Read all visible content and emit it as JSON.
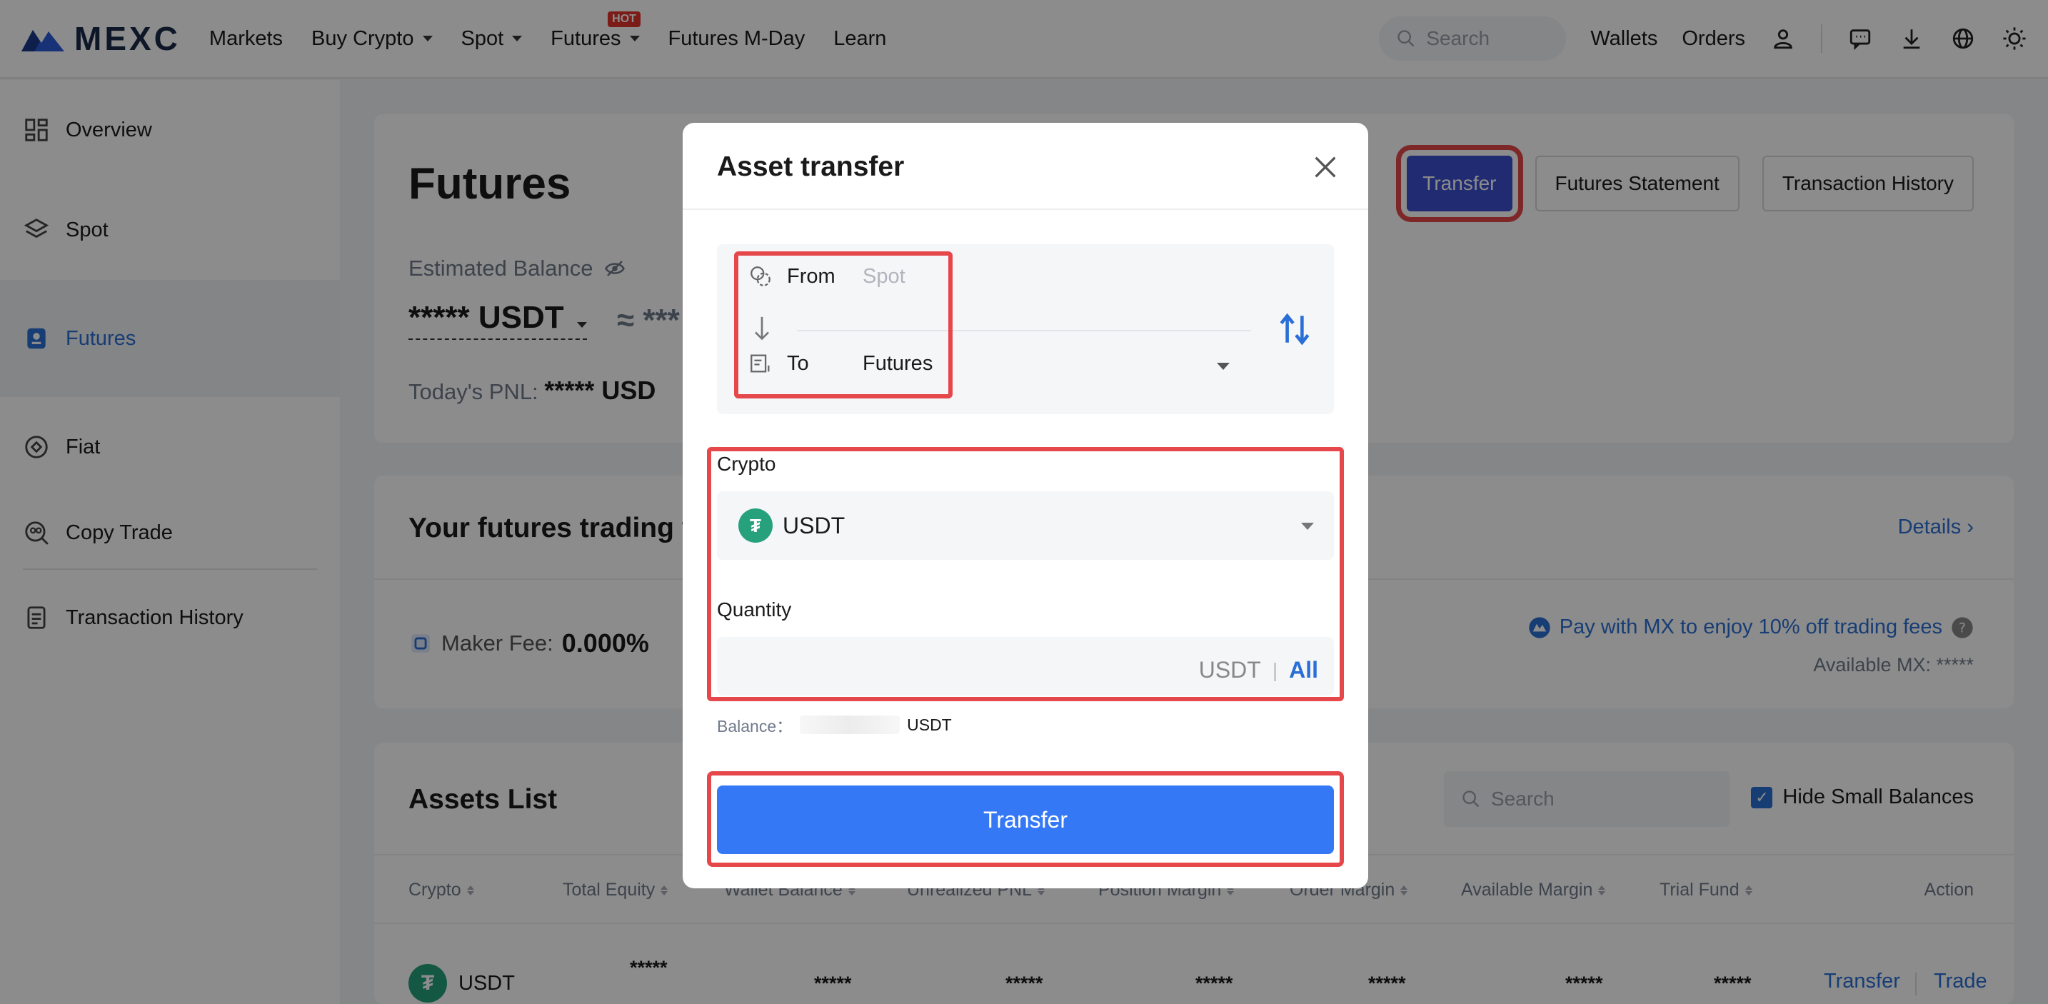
{
  "nav": {
    "logo": "MEXC",
    "items": [
      {
        "label": "Markets",
        "caret": false
      },
      {
        "label": "Buy Crypto",
        "caret": true
      },
      {
        "label": "Spot",
        "caret": true
      },
      {
        "label": "Futures",
        "caret": true
      },
      {
        "label": "Futures M-Day",
        "caret": false
      },
      {
        "label": "Learn",
        "caret": false
      }
    ],
    "hot_badge": "HOT",
    "search_placeholder": "Search",
    "wallets": "Wallets",
    "orders": "Orders"
  },
  "sidebar": {
    "items": [
      {
        "label": "Overview",
        "icon": "grid-icon"
      },
      {
        "label": "Spot",
        "icon": "layers-icon"
      },
      {
        "label": "Futures",
        "icon": "futures-icon",
        "active": true
      },
      {
        "label": "Fiat",
        "icon": "fiat-icon"
      },
      {
        "label": "Copy Trade",
        "icon": "copy-trade-icon"
      },
      {
        "label": "Transaction History",
        "icon": "document-icon"
      }
    ]
  },
  "futures_card": {
    "title": "Futures",
    "estimated_label": "Estimated Balance",
    "balance": "***** USDT",
    "approx": "≈ ***",
    "pnl_label": "Today's PNL:",
    "pnl_value": "***** USD",
    "buttons": {
      "transfer": "Transfer",
      "statement": "Futures Statement",
      "history": "Transaction History"
    }
  },
  "fees_card": {
    "title": "Your futures trading f",
    "details": "Details",
    "maker_label": "Maker Fee:",
    "maker_value": "0.000%",
    "pay_mx": "Pay with MX to enjoy 10% off trading fees",
    "available_mx": "Available MX: *****"
  },
  "assets": {
    "title": "Assets List",
    "search_placeholder": "Search",
    "hide_small": "Hide Small Balances",
    "columns": [
      "Crypto",
      "Total Equity",
      "Wallet Balance",
      "Unrealized PNL",
      "Position Margin",
      "Order Margin",
      "Available Margin",
      "Trial Fund",
      "Action"
    ],
    "row": {
      "crypto": "USDT",
      "total_equity": "*****",
      "wallet_balance": "*****",
      "unrealized_pnl": "*****",
      "position_margin": "*****",
      "order_margin": "*****",
      "available_margin": "*****",
      "trial_fund": "*****",
      "action_transfer": "Transfer",
      "action_trade": "Trade"
    }
  },
  "modal": {
    "title": "Asset transfer",
    "from_label": "From",
    "from_value": "Spot",
    "to_label": "To",
    "to_value": "Futures",
    "crypto_label": "Crypto",
    "crypto_value": "USDT",
    "quantity_label": "Quantity",
    "quantity_unit": "USDT",
    "quantity_sep": "|",
    "quantity_all": "All",
    "balance_label": "Balance：",
    "balance_unit": "USDT",
    "submit": "Transfer"
  },
  "colors": {
    "accent": "#3478f6",
    "highlight": "#e5474a",
    "link": "#2a6fd6",
    "usdt": "#26a17b"
  }
}
